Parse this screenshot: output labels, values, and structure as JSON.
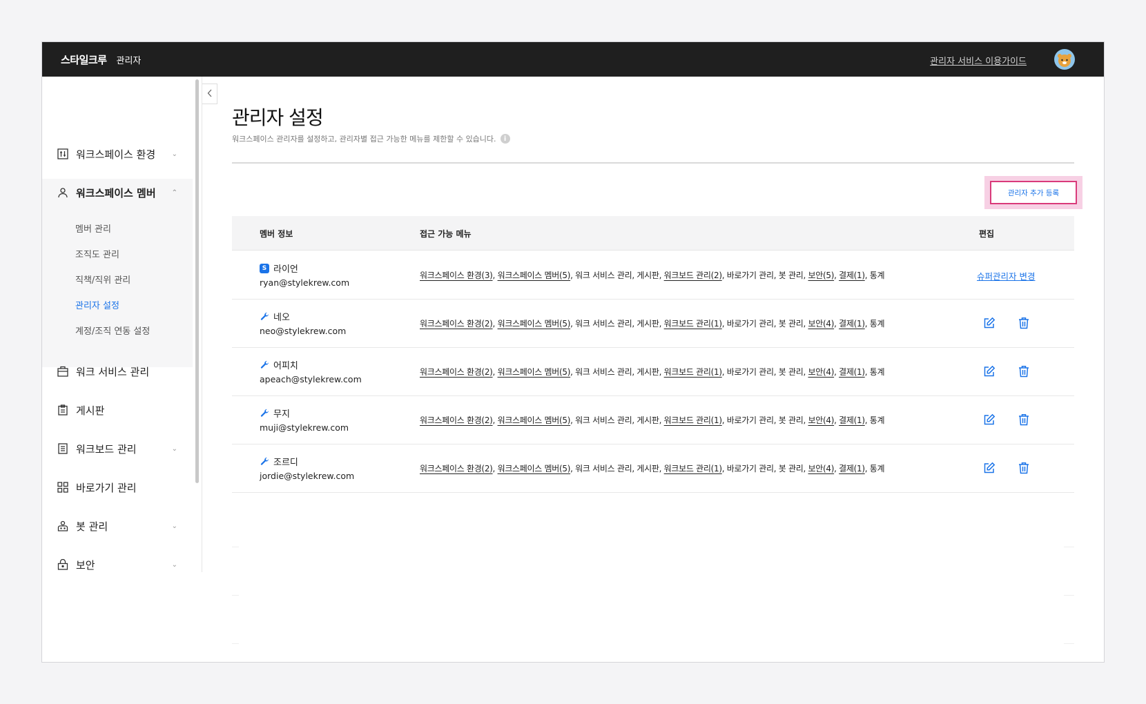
{
  "header": {
    "brand": "스타일크루",
    "brand_sub": "관리자",
    "guide_link": "관리자 서비스 이용가이드"
  },
  "sidebar": {
    "items": [
      {
        "label": "워크스페이스 환경"
      },
      {
        "label": "워크스페이스 멤버"
      },
      {
        "label": "워크 서비스 관리"
      },
      {
        "label": "게시판"
      },
      {
        "label": "워크보드 관리"
      },
      {
        "label": "바로가기 관리"
      },
      {
        "label": "봇 관리"
      },
      {
        "label": "보안"
      }
    ],
    "submenu": [
      {
        "label": "멤버 관리"
      },
      {
        "label": "조직도 관리"
      },
      {
        "label": "직책/직위 관리"
      },
      {
        "label": "관리자 설정"
      },
      {
        "label": "계정/조직 연동 설정"
      }
    ]
  },
  "main": {
    "title": "관리자 설정",
    "description": "워크스페이스 관리자를 설정하고, 관리자별 접근 가능한 메뉴를 제한할 수 있습니다.",
    "add_button": "관리자 추가 등록",
    "columns": {
      "member": "멤버 정보",
      "menus": "접근 가능 메뉴",
      "edit": "편집"
    },
    "super_link": "슈퍼관리자 변경",
    "rows": [
      {
        "name": "라이언",
        "email": "ryan@stylekrew.com",
        "role": "S",
        "m1": "워크스페이스 환경(3)",
        "m2": "워크스페이스 멤버(5)",
        "m3": ", 워크 서비스 관리, 게시판, ",
        "m4": "워크보드 관리(2)",
        "m5": ", 바로가기 관리, 봇 관리, ",
        "m6": "보안(5)",
        "m7": "결제(1)",
        "m8": ", 통계"
      },
      {
        "name": "네오",
        "email": "neo@stylekrew.com",
        "m1": "워크스페이스 환경(2)",
        "m2": "워크스페이스 멤버(5)",
        "m3": ", 워크 서비스 관리, 게시판, ",
        "m4": "워크보드 관리(1)",
        "m5": ", 바로가기 관리, 봇 관리, ",
        "m6": "보안(4)",
        "m7": "결제(1)",
        "m8": ", 통계"
      },
      {
        "name": "어피치",
        "email": "apeach@stylekrew.com",
        "m1": "워크스페이스 환경(2)",
        "m2": "워크스페이스 멤버(5)",
        "m3": ", 워크 서비스 관리, 게시판, ",
        "m4": "워크보드 관리(1)",
        "m5": ", 바로가기 관리, 봇 관리, ",
        "m6": "보안(4)",
        "m7": "결제(1)",
        "m8": ", 통계"
      },
      {
        "name": "무지",
        "email": "muji@stylekrew.com",
        "m1": "워크스페이스 환경(2)",
        "m2": "워크스페이스 멤버(5)",
        "m3": ", 워크 서비스 관리, 게시판, ",
        "m4": "워크보드 관리(1)",
        "m5": ", 바로가기 관리, 봇 관리, ",
        "m6": "보안(4)",
        "m7": "결제(1)",
        "m8": ", 통계"
      },
      {
        "name": "조르디",
        "email": "jordie@stylekrew.com",
        "m1": "워크스페이스 환경(2)",
        "m2": "워크스페이스 멤버(5)",
        "m3": ", 워크 서비스 관리, 게시판, ",
        "m4": "워크보드 관리(1)",
        "m5": ", 바로가기 관리, 봇 관리, ",
        "m6": "보안(4)",
        "m7": "결제(1)",
        "m8": ", 통계"
      }
    ]
  },
  "colors": {
    "accent": "#1a73e8",
    "highlight": "#d93a7a",
    "topbar": "#1f1f1f"
  }
}
